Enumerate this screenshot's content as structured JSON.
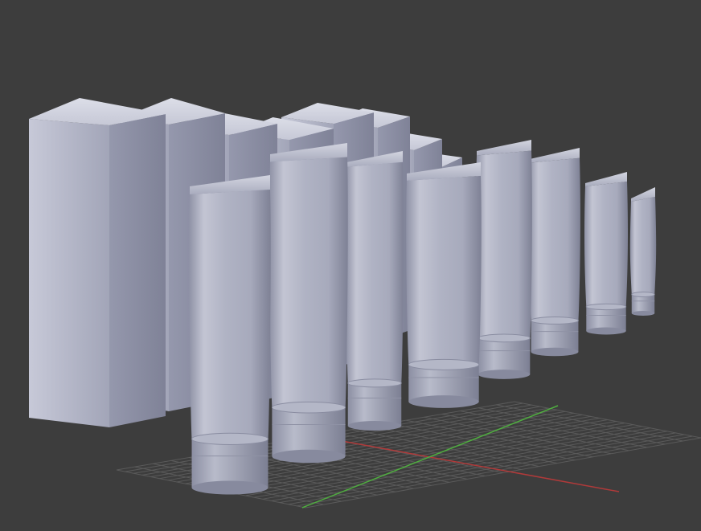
{
  "viewport": {
    "background_color": "#3d3d3d",
    "grid_color": "#5a5a5a",
    "x_axis_color": "#b03a3a",
    "y_axis_color": "#4fae3f"
  },
  "scene": {
    "object_color": "#b9bccb",
    "box_count": 8,
    "tube_count": 8
  }
}
